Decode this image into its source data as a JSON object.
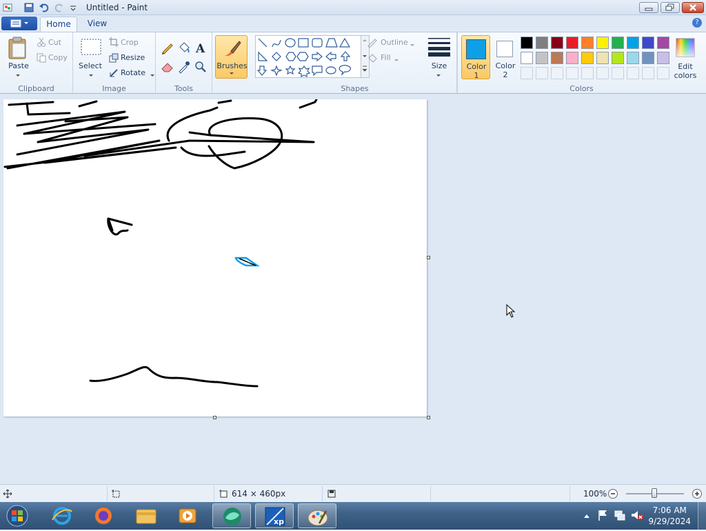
{
  "window": {
    "title": "Untitled - Paint"
  },
  "tabs": {
    "home": "Home",
    "view": "View"
  },
  "clipboard": {
    "paste": "Paste",
    "cut": "Cut",
    "copy": "Copy",
    "group": "Clipboard"
  },
  "image": {
    "select": "Select",
    "crop": "Crop",
    "resize": "Resize",
    "rotate": "Rotate",
    "group": "Image"
  },
  "tools": {
    "group": "Tools"
  },
  "brushes": {
    "label": "Brushes"
  },
  "shapes": {
    "outline": "Outline",
    "fill": "Fill",
    "group": "Shapes"
  },
  "size": {
    "label": "Size"
  },
  "colors": {
    "color1_line1": "Color",
    "color1_line2": "1",
    "color2_line1": "Color",
    "color2_line2": "2",
    "edit_line1": "Edit",
    "edit_line2": "colors",
    "group": "Colors",
    "color1": "#0ea0e6",
    "color2": "#ffffff",
    "palette_row1": [
      "#000000",
      "#7f7f7f",
      "#880015",
      "#ed1c24",
      "#ff7f27",
      "#fff200",
      "#22b14c",
      "#00a2e8",
      "#3f48cc",
      "#a349a4"
    ],
    "palette_row2": [
      "#ffffff",
      "#c3c3c3",
      "#b97a57",
      "#ffaec9",
      "#ffc90e",
      "#efe4b0",
      "#b5e61d",
      "#99d9ea",
      "#7092be",
      "#c8bfe7"
    ]
  },
  "status": {
    "dimensions": "614 × 460px",
    "zoom": "100%"
  },
  "clock": {
    "time": "7:06 AM",
    "date": "9/29/2024"
  }
}
